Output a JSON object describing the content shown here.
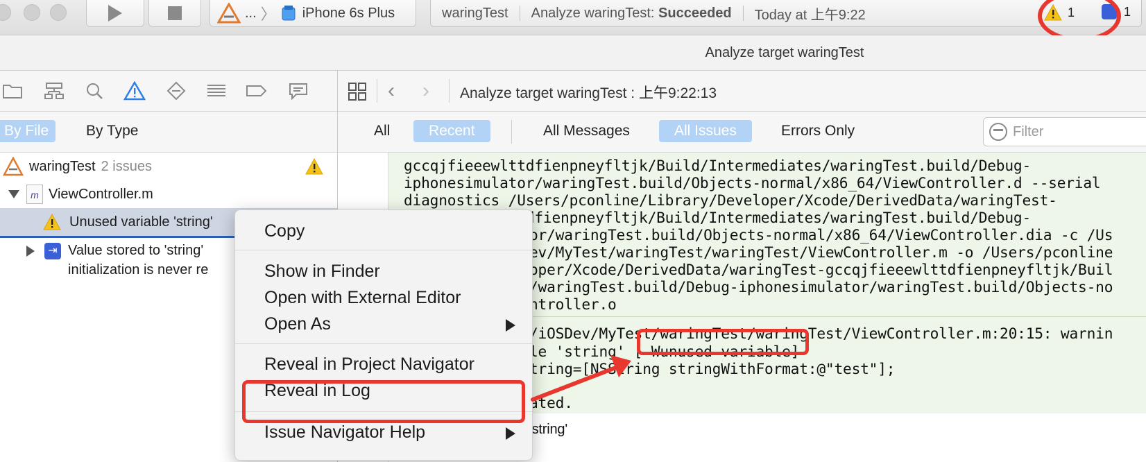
{
  "toolbar": {
    "scheme": {
      "ellipsis": "...",
      "device": "iPhone 6s Plus"
    },
    "activity": {
      "target": "waringTest",
      "status_prefix": "Analyze waringTest: ",
      "status_result": "Succeeded",
      "timestamp": "Today at 上午9:22"
    },
    "warning_count": "1",
    "issue_count": "1"
  },
  "window_title": "Analyze target waringTest",
  "navigator": {
    "tabs": {
      "by_file": "By File",
      "by_type": "By Type"
    },
    "project": {
      "name": "waringTest",
      "issues": "2 issues"
    },
    "file": "ViewController.m",
    "issues": [
      {
        "text": "Unused variable 'string'"
      },
      {
        "line1": "Value stored to 'string'",
        "line2": "initialization is never re"
      }
    ]
  },
  "editor": {
    "breadcrumb": "Analyze target waringTest : 上午9:22:13",
    "filters": {
      "all": "All",
      "recent": "Recent",
      "all_messages": "All Messages",
      "all_issues": "All Issues",
      "errors_only": "Errors Only"
    },
    "search_placeholder": "Filter",
    "log_lines": [
      "gccqjfieeewlttdfienpneyfltjk/Build/Intermediates/waringTest.build/Debug-",
      "iphonesimulator/waringTest.build/Objects-normal/x86_64/ViewController.d --serial",
      "diagnostics /Users/pconline/Library/Developer/Xcode/DerivedData/waringTest-",
      "gccqjfieeewlttdfienpneyfltjk/Build/Intermediates/waringTest.build/Debug-",
      "or/waringTest.build/Objects-normal/x86_64/ViewController.dia -c /Us",
      "ev/MyTest/waringTest/waringTest/ViewController.m -o /Users/pconline",
      "oper/Xcode/DerivedData/waringTest-gccqjfieeewlttdfienpneyfltjk/Buil",
      "/waringTest.build/Debug-iphonesimulator/waringTest.build/Objects-no",
      "ntroller.o"
    ],
    "warning_lines": {
      "path": "/iOSDev/MyTest/waringTest/waringTest/ViewController.m:20:15: warnin",
      "var_fragment": "le 'string' ",
      "flag": "[-Wunused-variable]",
      "code": "tring=[NSString stringWithFormat:@\"test\"];",
      "generated": "ated.",
      "string_note": "'string'"
    }
  },
  "context_menu": {
    "items": [
      {
        "label": "Copy"
      },
      {
        "label": "Show in Finder"
      },
      {
        "label": "Open with External Editor"
      },
      {
        "label": "Open As"
      },
      {
        "label": "Reveal in Project Navigator"
      },
      {
        "label": "Reveal in Log"
      },
      {
        "label": "Issue Navigator Help"
      }
    ]
  },
  "colors": {
    "selection_blue": "#b3d3f6",
    "annotation_red": "#e8372f",
    "log_background": "#edf6e8",
    "warning_yellow": "#f5c21b"
  }
}
